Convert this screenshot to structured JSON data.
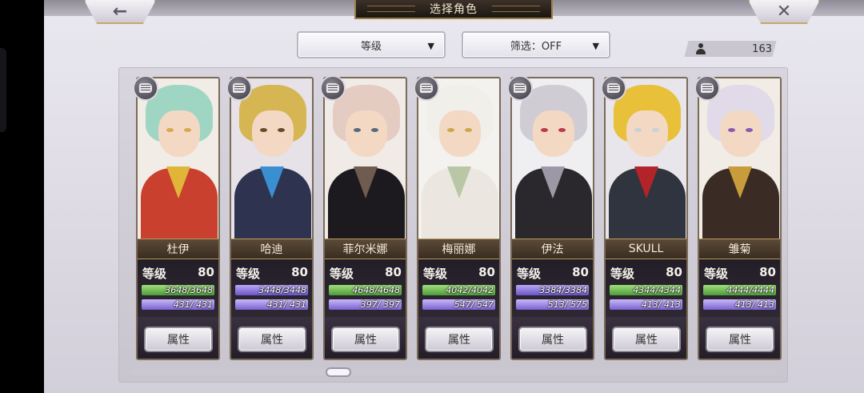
{
  "header": {
    "title": "选择角色",
    "back_icon": "←",
    "close_icon": "✕"
  },
  "controls": {
    "sort_label": "等级",
    "filter_label": "筛选：OFF",
    "arrow": "▼",
    "count": "163"
  },
  "level_label": "等级",
  "attr_label": "属性",
  "characters": [
    {
      "name": "杜伊",
      "level": "80",
      "hp": "3648/3648",
      "mp": "431/ 431",
      "hp_color": "green",
      "hair": "#9fd6c3",
      "body": "#c9402f",
      "accent": "#e0b53a",
      "eye": "#d7a94a",
      "bg": "#f1ede6"
    },
    {
      "name": "哈迪",
      "level": "80",
      "hp": "3448/3448",
      "mp": "431/ 431",
      "hp_color": "blue",
      "hair": "#d6b553",
      "body": "#2e3350",
      "accent": "#3a8fd0",
      "eye": "#6a4a2a",
      "bg": "#e6e2e8"
    },
    {
      "name": "菲尔米娜",
      "level": "80",
      "hp": "4648/4648",
      "mp": "397/ 397",
      "hp_color": "green",
      "hair": "#e5ccc3",
      "body": "#1c1a1e",
      "accent": "#6f5b4f",
      "eye": "#5a6a78",
      "bg": "#f0ebe6"
    },
    {
      "name": "梅丽娜",
      "level": "80",
      "hp": "4042/4042",
      "mp": "547/ 547",
      "hp_color": "green",
      "hair": "#f1efe9",
      "body": "#ebe7e0",
      "accent": "#b9c7a6",
      "eye": "#cda84a",
      "bg": "#f4f2ee"
    },
    {
      "name": "伊法",
      "level": "80",
      "hp": "3384/3384",
      "mp": "513/ 575",
      "hp_color": "blue",
      "hair": "#cfcdd3",
      "body": "#2a282c",
      "accent": "#9d98a6",
      "eye": "#b83c4a",
      "bg": "#efeef1"
    },
    {
      "name": "SKULL",
      "level": "80",
      "hp": "4344/4344",
      "mp": "413/ 413",
      "hp_color": "green",
      "hair": "#e8c03a",
      "body": "#30343e",
      "accent": "#b3242a",
      "eye": "#c8d0d8",
      "bg": "#e8e6ea"
    },
    {
      "name": "雏菊",
      "level": "80",
      "hp": "4444/4444",
      "mp": "413/ 413",
      "hp_color": "green",
      "hair": "#e1dae8",
      "body": "#3a2c24",
      "accent": "#c89c3a",
      "eye": "#8a5ab0",
      "bg": "#f1ece6"
    }
  ]
}
